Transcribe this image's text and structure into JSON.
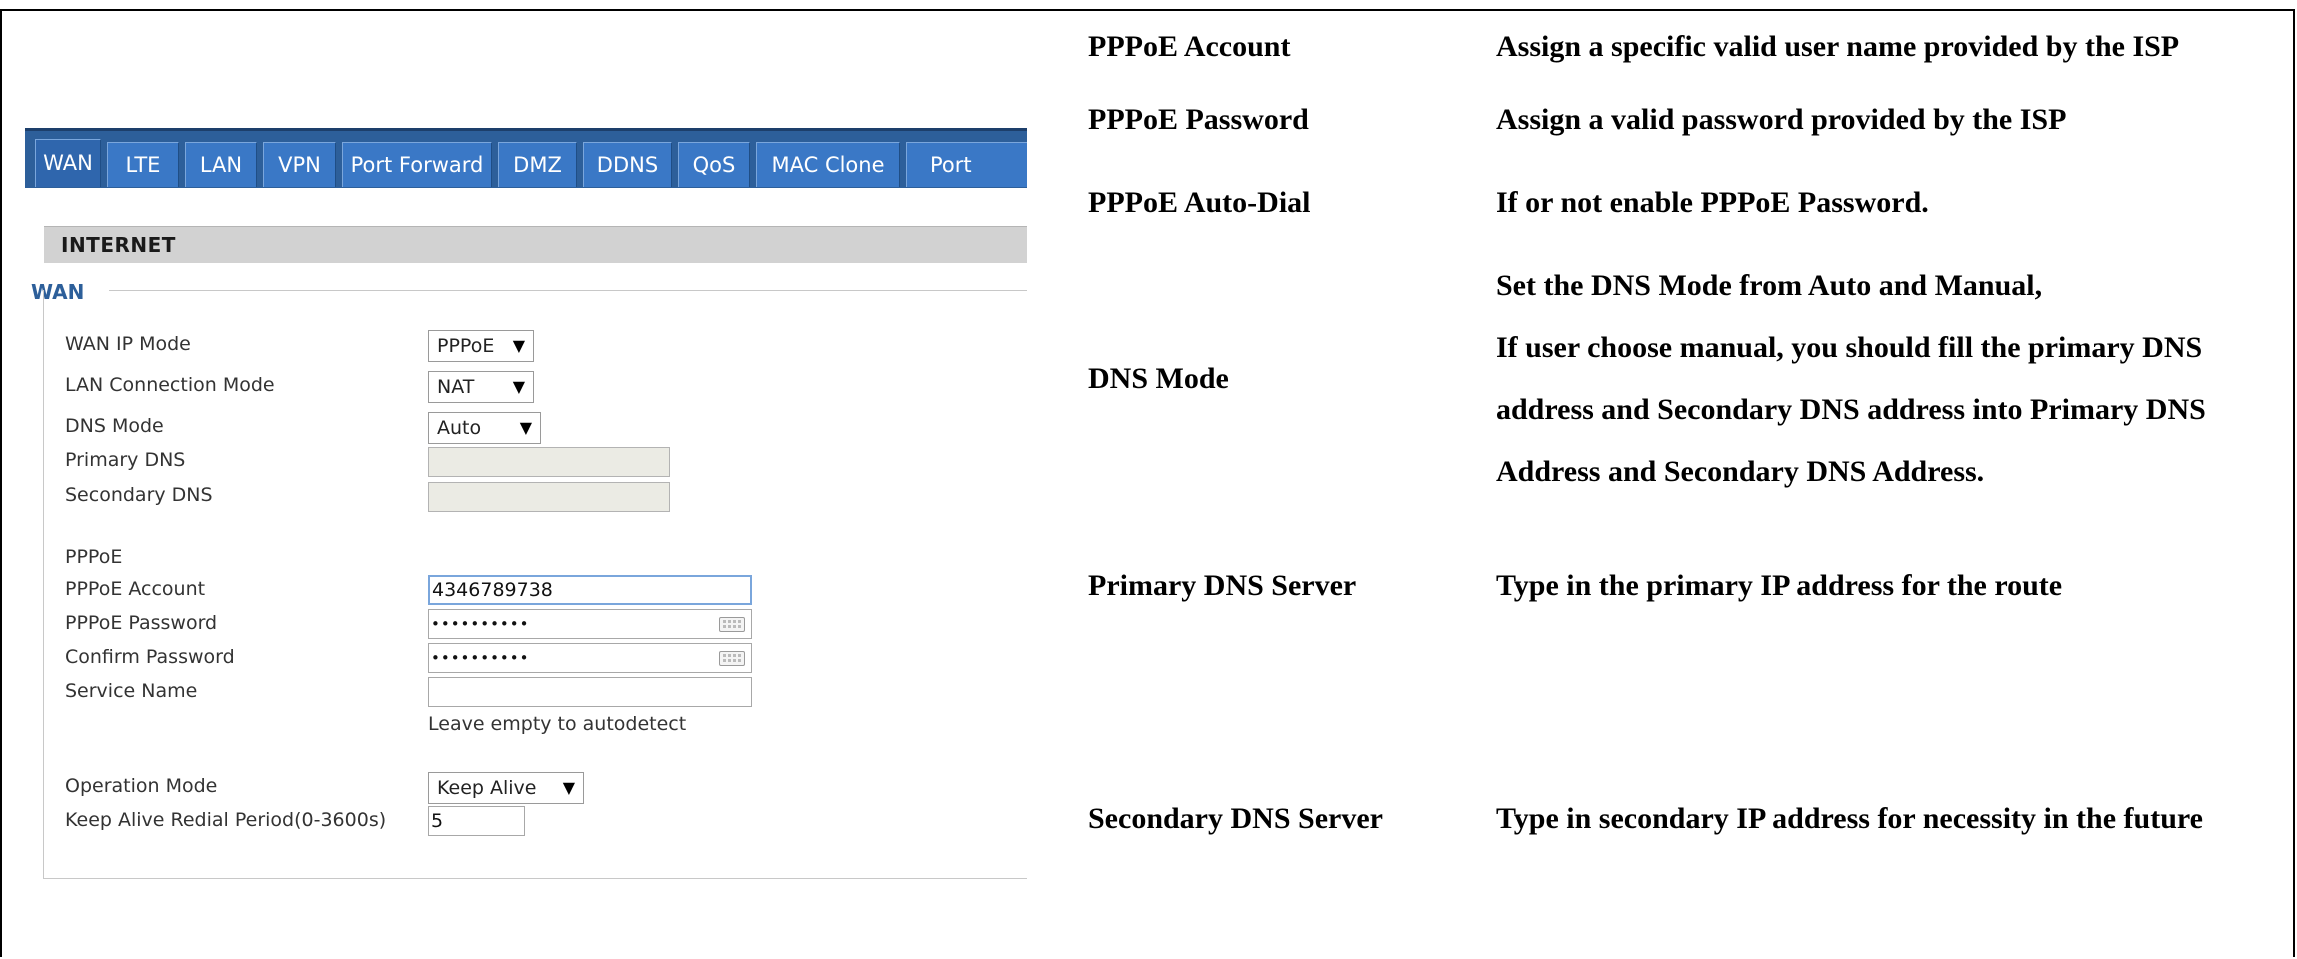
{
  "tabs": [
    "WAN",
    "LTE",
    "LAN",
    "VPN",
    "Port Forward",
    "DMZ",
    "DDNS",
    "QoS",
    "MAC Clone",
    "Port"
  ],
  "section_title": "INTERNET",
  "wan_heading": "WAN",
  "form": {
    "wan_ip_mode": {
      "label": "WAN IP Mode",
      "value": "PPPoE"
    },
    "lan_connection_mode": {
      "label": "LAN Connection Mode",
      "value": "NAT"
    },
    "dns_mode": {
      "label": "DNS Mode",
      "value": "Auto"
    },
    "primary_dns": {
      "label": "Primary DNS",
      "value": ""
    },
    "secondary_dns": {
      "label": "Secondary DNS",
      "value": ""
    },
    "pppoe_group_label": "PPPoE",
    "pppoe_account": {
      "label": "PPPoE Account",
      "value": "4346789738"
    },
    "pppoe_password": {
      "label": "PPPoE Password",
      "value": "••••••••••"
    },
    "confirm_password": {
      "label": "Confirm Password",
      "value": "••••••••••"
    },
    "service_name": {
      "label": "Service Name",
      "value": "",
      "hint": "Leave empty to autodetect"
    },
    "operation_mode": {
      "label": "Operation Mode",
      "value": "Keep Alive"
    },
    "keep_alive_period": {
      "label": "Keep Alive Redial Period(0-3600s)",
      "value": "5"
    }
  },
  "dropdown_arrow": "▼",
  "description_table": [
    {
      "term": "PPPoE Account",
      "desc": [
        "Assign a specific valid user name provided by the ISP"
      ]
    },
    {
      "term": "PPPoE Password",
      "desc": [
        "Assign a valid password provided by the ISP"
      ]
    },
    {
      "term": "PPPoE Auto-Dial",
      "desc": [
        "If or not enable PPPoE Password."
      ]
    },
    {
      "term": "DNS Mode",
      "desc": [
        "Set the DNS Mode from Auto and Manual,",
        "If user choose manual, you should fill the primary DNS",
        "address and Secondary DNS address into Primary DNS",
        "Address and Secondary DNS Address."
      ]
    },
    {
      "term": "Primary DNS Server",
      "desc": [
        "Type in the primary IP address for the route"
      ]
    },
    {
      "term": "Secondary DNS Server",
      "desc": [
        "Type in secondary IP address for necessity in the future"
      ]
    }
  ],
  "colors": {
    "tab_bar": "#2d5f9a",
    "tab": "#3a78c6",
    "heading_blue": "#2d5f9a",
    "section_bg": "#d2d2d2"
  }
}
